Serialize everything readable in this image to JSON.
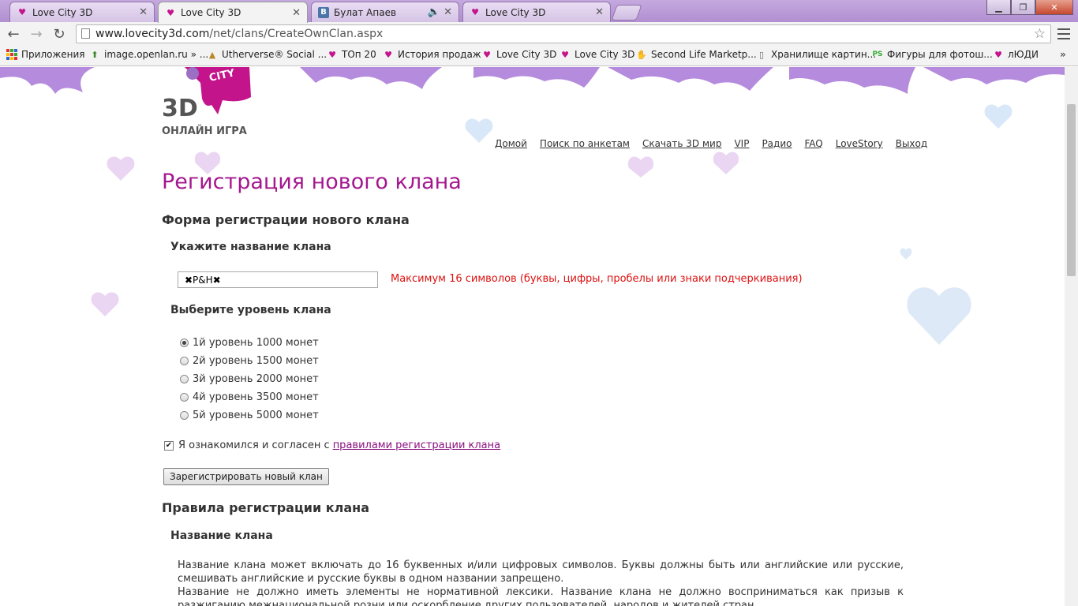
{
  "browser": {
    "tabs": [
      {
        "title": "Love City 3D",
        "active": false
      },
      {
        "title": "Love City 3D",
        "active": true
      },
      {
        "title": "Булат Апаев",
        "active": false,
        "audio": true
      },
      {
        "title": "Love City 3D",
        "active": false
      }
    ],
    "url_host": "www.lovecity3d.com",
    "url_path": "/net/clans/CreateOwnClan.aspx",
    "bookmarks": [
      {
        "label": "Приложения",
        "icon": "apps-icon"
      },
      {
        "label": "image.openlan.ru » ...",
        "icon": "arrow-up-icon"
      },
      {
        "label": "Utherverse® Social ...",
        "icon": "hat-icon"
      },
      {
        "label": "ТОп 20",
        "icon": "lovecity-icon"
      },
      {
        "label": "История продаж",
        "icon": "lovecity-icon"
      },
      {
        "label": "Love City 3D",
        "icon": "lovecity-icon"
      },
      {
        "label": "Love City 3D",
        "icon": "lovecity-icon"
      },
      {
        "label": "Second Life Marketp...",
        "icon": "hand-icon"
      },
      {
        "label": "Хранилище картин...",
        "icon": "page-icon"
      },
      {
        "label": "Фигуры для фотош...",
        "icon": "ps-icon"
      },
      {
        "label": "лЮДИ",
        "icon": "lovecity-icon"
      }
    ],
    "colors": {
      "tabbar": "#b79ad4",
      "accent": "#c4148c"
    }
  },
  "logo": {
    "line1": "3D",
    "line2": "ОНЛАЙН ИГРА"
  },
  "nav": [
    "Домой",
    "Поиск по анкетам",
    "Скачать 3D мир",
    "VIP",
    "Радио",
    "FAQ",
    "LoveStory",
    "Выход"
  ],
  "page": {
    "title": "Регистрация нового клана",
    "form_heading": "Форма регистрации нового клана",
    "name_label": "Укажите название клана",
    "name_value": "✖P&H✖",
    "name_hint": "Максимум 16 символов (буквы, цифры, пробелы или знаки подчеркивания)",
    "level_label": "Выберите уровень клана",
    "levels": [
      {
        "label": "1й уровень 1000 монет",
        "selected": true
      },
      {
        "label": "2й уровень 1500 монет",
        "selected": false
      },
      {
        "label": "3й уровень 2000 монет",
        "selected": false
      },
      {
        "label": "4й уровень 3500 монет",
        "selected": false
      },
      {
        "label": "5й уровень 5000 монет",
        "selected": false
      }
    ],
    "agree_text": "Я ознакомился и согласен с",
    "agree_link": "правилами регистрации клана",
    "agree_checked": true,
    "submit_label": "Зарегистрировать новый клан",
    "rules_heading": "Правила регистрации клана",
    "rules_sub": "Название клана",
    "rules_p1": "Название клана может включать до 16 буквенных и/или цифровых символов. Буквы должны быть или английские или русские, смешивать английские и русские буквы в одном названии запрещено.",
    "rules_p2": "Название не должно иметь элементы не нормативной лексики. Название клана не должно восприниматься как призыв к разжиганию межнациональной розни или оскорбление других пользователей, народов и жителей стран."
  }
}
